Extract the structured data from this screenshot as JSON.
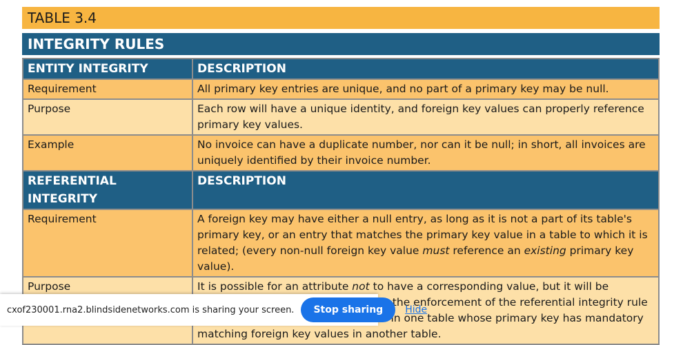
{
  "caption": "TABLE 3.4",
  "title": "INTEGRITY RULES",
  "sections": [
    {
      "header": [
        "ENTITY INTEGRITY",
        "DESCRIPTION"
      ],
      "rows": [
        {
          "label": "Requirement",
          "text": "All primary key entries are unique, and no part of a primary key may be null."
        },
        {
          "label": "Purpose",
          "text": "Each row will have a unique identity, and foreign key values can properly reference primary key values."
        },
        {
          "label": "Example",
          "text": "No invoice can have a duplicate number, nor can it be null; in short, all invoices are uniquely identified by their invoice number."
        }
      ]
    },
    {
      "header": [
        "REFERENTIAL INTEGRITY",
        "DESCRIPTION"
      ],
      "rows": [
        {
          "label": "Requirement",
          "text_a": "A foreign key may have either a null entry, as long as it is not a part of its table's primary key, or an entry that matches the primary key value in a table to which it is related; (every non-null foreign key value ",
          "em_1": "must",
          "text_b": " reference an ",
          "em_2": "existing",
          "text_c": " primary key value)."
        },
        {
          "label": "Purpose",
          "text_a": "It is possible for an attribute ",
          "em_1": "not",
          "text_b": " to have a corresponding value, but it will be impossible to have an invalid entry; the enforcement of the referential integrity rule makes it impossible to delete a row in one table whose primary key has mandatory matching foreign key values in another table."
        }
      ]
    }
  ],
  "share_bar": {
    "message": "cxof230001.rna2.blindsidenetworks.com is sharing your screen.",
    "stop_label": "Stop sharing",
    "hide_label": "Hide"
  },
  "colors": {
    "caption_bg": "#f7b541",
    "header_bg": "#1f5f85",
    "row_odd": "#fbc36c",
    "row_even": "#fde0a8",
    "button_blue": "#1a73e8"
  }
}
